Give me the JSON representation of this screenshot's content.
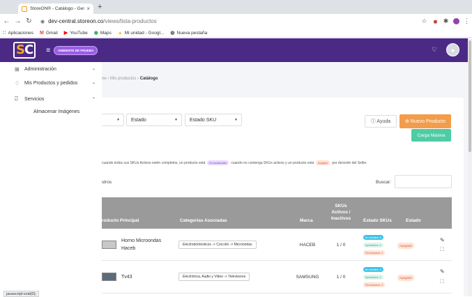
{
  "browser": {
    "tab_title": "StoreON® - Catálogo - Gestión",
    "tab_close": "×",
    "new_tab": "+",
    "back": "←",
    "forward": "→",
    "reload": "↻",
    "url_domain": "dev-central.storeon.co",
    "url_path": "/views/lista-productos",
    "bookmarks": [
      {
        "label": "Aplicaciones",
        "icon": "apps-grid-icon",
        "glyph": "∷",
        "color": "#4285f4"
      },
      {
        "label": "Gmail",
        "icon": "gmail-icon",
        "glyph": "M",
        "color": "#ea4335"
      },
      {
        "label": "YouTube",
        "icon": "youtube-icon",
        "glyph": "▶",
        "color": "#ff0000"
      },
      {
        "label": "Maps",
        "icon": "maps-icon",
        "glyph": "◉",
        "color": "#34a853"
      },
      {
        "label": "Mi unidad - Googl...",
        "icon": "drive-icon",
        "glyph": "▲",
        "color": "#fbbc04"
      },
      {
        "label": "Nueva pestaña",
        "icon": "globe-icon",
        "glyph": "◍",
        "color": "#555555"
      }
    ]
  },
  "app": {
    "logo_s": "S",
    "logo_c": "C",
    "env_badge": "AMBIENTE DE PRUEBA",
    "colors": {
      "topbar": "#4b2a86",
      "primary_orange": "#f39c4a",
      "green": "#4ecca3"
    }
  },
  "sidebar": {
    "items": [
      {
        "label": "Administración",
        "chevron": "⌄",
        "icon": "grid-icon",
        "glyph": "⊞"
      },
      {
        "label": "Mis Productos y pedidos",
        "chevron": "⌄",
        "icon": "tag-icon",
        "glyph": "♢"
      },
      {
        "label": "Servicios",
        "chevron": "⌃",
        "icon": "link-icon",
        "glyph": "⍁"
      }
    ],
    "sub_items": [
      {
        "label": "Almacenar Imágenes"
      }
    ]
  },
  "breadcrumb": {
    "partial": "ne",
    "sep1": "›",
    "mis_productos": "Mis productos",
    "sep2": "›",
    "current": "Catálogo"
  },
  "filters": {
    "partial_select_caret": "♦",
    "estado": "Estado",
    "estado_sku": "Estado SKU",
    "caret": "♦"
  },
  "actions": {
    "help": "ⓘ Ayuda",
    "new_product": "⊕ Nuevo Producto",
    "bulk_load": "Carga Masiva"
  },
  "info": {
    "part1": "cuando todos sus SKUs Activos estén completos, un producto está",
    "pill1": "En construcción",
    "part2": "cuando no contenga SKUs activos y un producto está",
    "pill2": "Apagado",
    "part3": "por decisión del Seller."
  },
  "table_controls": {
    "entries_partial": "stros",
    "search_label": "Buscar:"
  },
  "table": {
    "headers": {
      "producto": "roducto Principal",
      "categorias": "Categorías Asociadas",
      "marca": "Marca",
      "skus1": "SKUs",
      "skus2": "Activos /",
      "skus3": "Inactivos",
      "estado_skus": "Estado SKUs",
      "estado": "Estado"
    },
    "rows": [
      {
        "name1": "Horno Microondas",
        "name2": "Haceb",
        "category": "Electrodomésticos -> Cocción -> Microondas",
        "brand": "HACEB",
        "skus": "1 / 0",
        "status_review": "En revisión: 0",
        "status_approved": "Aprobados: 1",
        "status_rejected": "Rechazados: 0",
        "state": "Apagado",
        "edit_icon": "✎",
        "delete_icon": "⬚"
      },
      {
        "name1": "Tv43",
        "name2": "",
        "category": "Electrónica, Audio y Video -> Televisores",
        "brand": "SAMSUNG",
        "skus": "1 / 0",
        "status_review": "En revisión: 0",
        "status_approved": "Aprobados: 1",
        "status_rejected": "Rechazados: 0",
        "state": "Apagado",
        "edit_icon": "✎",
        "delete_icon": "⬚"
      }
    ]
  },
  "status_bar": "javascript:void(0);"
}
